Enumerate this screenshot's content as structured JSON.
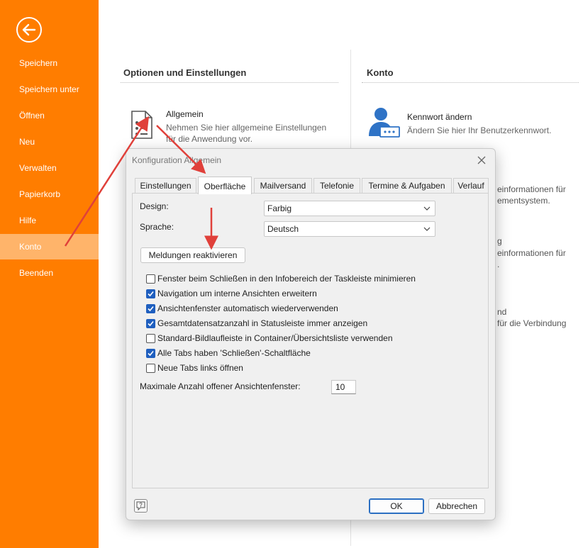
{
  "sidebar": {
    "items": [
      {
        "label": "Speichern"
      },
      {
        "label": "Speichern unter"
      },
      {
        "label": "Öffnen"
      },
      {
        "label": "Neu"
      },
      {
        "label": "Verwalten"
      },
      {
        "label": "Papierkorb"
      },
      {
        "label": "Hilfe"
      },
      {
        "label": "Konto",
        "active": true
      },
      {
        "label": "Beenden"
      }
    ]
  },
  "options": {
    "title": "Optionen und Einstellungen",
    "general": {
      "title": "Allgemein",
      "desc_line1": "Nehmen Sie hier allgemeine Einstellungen",
      "desc_line2": "für die Anwendung vor."
    }
  },
  "account": {
    "title": "Konto",
    "password": {
      "title": "Kennwort ändern",
      "desc": "Ändern Sie hier Ihr Benutzerkennwort."
    },
    "partial_texts": [
      "einformationen für",
      "ementsystem.",
      "g",
      "einformationen für",
      ".",
      "nd",
      "für die Verbindung"
    ]
  },
  "dialog": {
    "title": "Konfiguration Allgemein",
    "tabs": [
      {
        "label": "Einstellungen"
      },
      {
        "label": "Oberfläche",
        "active": true
      },
      {
        "label": "Mailversand"
      },
      {
        "label": "Telefonie"
      },
      {
        "label": "Termine & Aufgaben"
      },
      {
        "label": "Verlauf"
      }
    ],
    "design_label": "Design:",
    "design_value": "Farbig",
    "language_label": "Sprache:",
    "language_value": "Deutsch",
    "reactivate_button": "Meldungen reaktivieren",
    "checkboxes": [
      {
        "label": "Fenster beim Schließen in den Infobereich der Taskleiste minimieren",
        "checked": false
      },
      {
        "label": "Navigation um interne Ansichten erweitern",
        "checked": true
      },
      {
        "label": "Ansichtenfenster automatisch wiederverwenden",
        "checked": true
      },
      {
        "label": "Gesamtdatensatzanzahl in Statusleiste immer anzeigen",
        "checked": true
      },
      {
        "label": "Standard-Bildlaufleiste in Container/Übersichtsliste verwenden",
        "checked": false
      },
      {
        "label": "Alle Tabs haben 'Schließen'-Schaltfläche",
        "checked": true
      },
      {
        "label": "Neue Tabs links öffnen",
        "checked": false
      }
    ],
    "max_windows_label": "Maximale Anzahl offener Ansichtenfenster:",
    "max_windows_value": "10",
    "ok_button": "OK",
    "cancel_button": "Abbrechen"
  },
  "colors": {
    "sidebar": "#ff7d00",
    "sidebar_active": "#ffb46a",
    "accent": "#1f5fbf",
    "annotation_arrow": "#e0403a"
  },
  "icons": [
    "back-arrow-icon",
    "settings-document-icon",
    "user-password-icon",
    "close-icon",
    "chevron-down-icon",
    "check-icon",
    "help-icon"
  ]
}
